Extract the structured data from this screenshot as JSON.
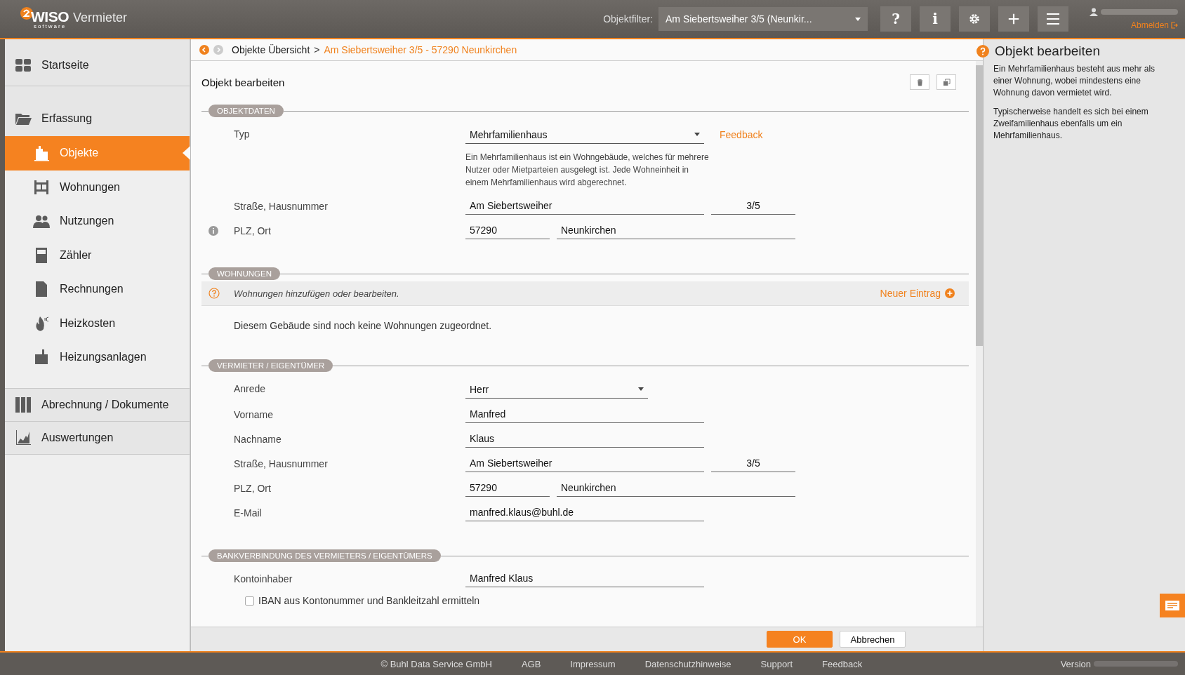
{
  "app": {
    "logo_main": "WISO",
    "logo_sub": "software",
    "product": "Vermieter"
  },
  "topbar": {
    "filter_label": "Objektfilter:",
    "filter_value": "Am Siebertsweiher 3/5 (Neunkir...",
    "tools": [
      {
        "kind": "glyph",
        "text": "?"
      },
      {
        "kind": "glyph",
        "text": "i"
      },
      {
        "kind": "gear"
      },
      {
        "kind": "plus"
      },
      {
        "kind": "menu"
      }
    ],
    "logout": "Abmelden"
  },
  "sidebar": [
    {
      "kind": "section",
      "label": "Startseite",
      "selected": false
    },
    {
      "kind": "section",
      "label": "Erfassung",
      "selected": false
    },
    {
      "kind": "sub",
      "label": "Objekte",
      "selected": true
    },
    {
      "kind": "sub",
      "label": "Wohnungen",
      "selected": false
    },
    {
      "kind": "sub",
      "label": "Nutzungen",
      "selected": false
    },
    {
      "kind": "sub",
      "label": "Zähler",
      "selected": false
    },
    {
      "kind": "sub",
      "label": "Rechnungen",
      "selected": false
    },
    {
      "kind": "sub",
      "label": "Heizkosten",
      "selected": false
    },
    {
      "kind": "sub",
      "label": "Heizungsanlagen",
      "selected": false
    },
    {
      "kind": "section",
      "label": "Abrechnung / Dokumente",
      "selected": false
    },
    {
      "kind": "section",
      "label": "Auswertungen",
      "selected": false
    }
  ],
  "breadcrumb_separator": ">",
  "breadcrumb": [
    {
      "text": "Objekte Übersicht",
      "current": false
    },
    {
      "text": "Am Siebertsweiher 3/5 - 57290 Neunkirchen",
      "current": true
    }
  ],
  "form": {
    "title": "Objekt bearbeiten",
    "sections": [
      {
        "title": "OBJEKTDATEN",
        "rows": [
          {
            "kind": "select",
            "label": "Typ",
            "value": "Mehrfamilienhaus",
            "link": "Feedback",
            "note": "Ein Mehrfamilienhaus ist ein Wohngebäude, welches für mehrere Nutzer oder Mietparteien ausgelegt ist. Jede Wohneinheit in einem Mehrfamilienhaus wird abgerechnet."
          },
          {
            "kind": "pair",
            "label": "Straße, Hausnummer",
            "info": false,
            "values": [
              "Am Siebertsweiher",
              "3/5"
            ]
          },
          {
            "kind": "pair-rev",
            "label": "PLZ, Ort",
            "info": true,
            "values": [
              "57290",
              "Neunkirchen"
            ]
          }
        ]
      },
      {
        "title": "WOHNUNGEN",
        "hint": "Wohnungen hinzufügen oder bearbeiten.",
        "action": "Neuer Eintrag",
        "empty": "Diesem Gebäude sind noch keine Wohnungen zugeordnet."
      },
      {
        "title": "VERMIETER / EIGENTÜMER",
        "rows": [
          {
            "kind": "select",
            "label": "Anrede",
            "value": "Herr"
          },
          {
            "kind": "text",
            "label": "Vorname",
            "value": "Manfred"
          },
          {
            "kind": "text",
            "label": "Nachname",
            "value": "Klaus"
          },
          {
            "kind": "pair",
            "label": "Straße, Hausnummer",
            "info": false,
            "values": [
              "Am Siebertsweiher",
              "3/5"
            ]
          },
          {
            "kind": "pair-rev",
            "label": "PLZ, Ort",
            "info": false,
            "values": [
              "57290",
              "Neunkirchen"
            ]
          },
          {
            "kind": "text",
            "label": "E-Mail",
            "value": "manfred.klaus@buhl.de"
          }
        ]
      },
      {
        "title": "BANKVERBINDUNG DES VERMIETERS / EIGENTÜMERS",
        "rows": [
          {
            "kind": "text",
            "label": "Kontoinhaber",
            "value": "Manfred Klaus"
          },
          {
            "kind": "checkbox",
            "label": "IBAN aus Kontonummer und Bankleitzahl ermitteln",
            "checked": false
          }
        ]
      }
    ]
  },
  "actions": [
    "OK",
    "Abbrechen"
  ],
  "help": {
    "title": "Objekt bearbeiten",
    "paragraphs": [
      "Ein Mehrfamilienhaus besteht aus mehr als einer Wohnung, wobei mindestens eine Wohnung davon vermietet wird.",
      "Typischerweise handelt es sich bei einem Zweifamilienhaus ebenfalls um ein Mehrfamilienhaus."
    ]
  },
  "footer": {
    "links": [
      "© Buhl Data Service GmbH",
      "AGB",
      "Impressum",
      "Datenschutzhinweise",
      "Support",
      "Feedback"
    ],
    "version_label": "Version"
  }
}
